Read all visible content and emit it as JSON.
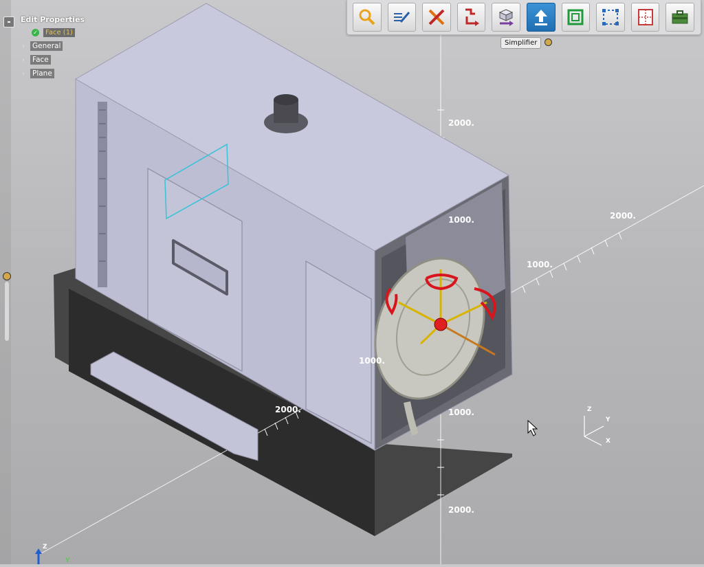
{
  "panel": {
    "title": "Edit Properties",
    "selection_label": "Face (1)",
    "tree_items": [
      "General",
      "Face",
      "Plane"
    ]
  },
  "toolbar": {
    "tools": [
      {
        "name": "inspect-tool",
        "icon": "magnifier-icon"
      },
      {
        "name": "annotate-tool",
        "icon": "pen-lines-icon"
      },
      {
        "name": "repair-tool",
        "icon": "wrench-screwdriver-icon"
      },
      {
        "name": "prepare-tool",
        "icon": "stair-arrow-icon"
      },
      {
        "name": "move-tool",
        "icon": "cube-arrow-icon"
      },
      {
        "name": "simplifier-tool",
        "icon": "upload-arrow-icon",
        "active": true
      },
      {
        "name": "midsurface-tool",
        "icon": "green-square-icon"
      },
      {
        "name": "extract-tool",
        "icon": "dotted-box-icon"
      },
      {
        "name": "share-tool",
        "icon": "grid-sheet-icon"
      },
      {
        "name": "toolbox-tool",
        "icon": "briefcase-icon"
      }
    ],
    "tooltip": "Simplifier"
  },
  "scale_labels": {
    "v_2000_top": "2000.",
    "v_1000_top": "1000.",
    "v_1000_bottom": "1000.",
    "v_2000_bottom": "2000.",
    "d_2000_right": "2000.",
    "d_1000_right": "1000.",
    "d_1000_left": "1000.",
    "d_2000_left": "2000."
  },
  "triad": {
    "z": "Z",
    "y": "Y",
    "x": "X"
  },
  "corner_axis": {
    "z": "Z",
    "y": "Y"
  },
  "colors": {
    "housing": "#c8c8dc",
    "accent_blue": "#2a7fc4",
    "gizmo_red": "#d8141c",
    "gizmo_yellow": "#d8b400",
    "selection_cyan": "#3fc3d9"
  }
}
